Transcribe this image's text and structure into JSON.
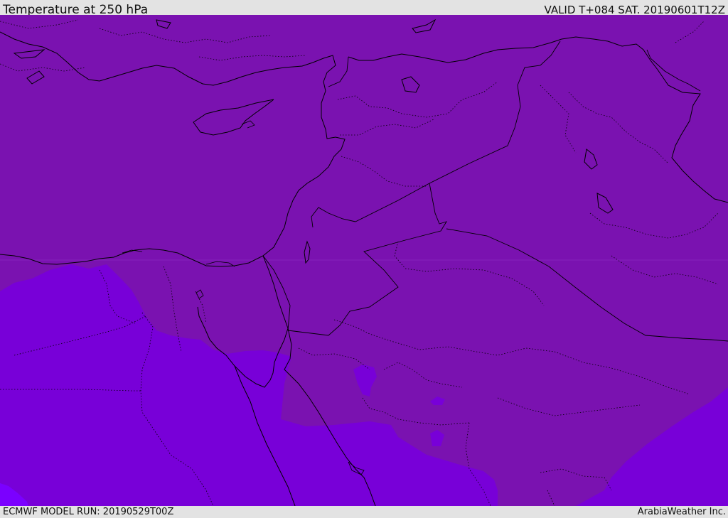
{
  "header": {
    "title": "Temperature at 250 hPa",
    "valid": "VALID T+084 SAT. 20190601T12Z"
  },
  "footer": {
    "model_run": "ECMWF MODEL RUN: 20190529T00Z",
    "credit": "ArabiaWeather Inc."
  },
  "colors": {
    "warm_band": "#7a12b0",
    "cool_band": "#7800d8",
    "coldest_band": "#7b00ff",
    "borders": "#000000"
  }
}
